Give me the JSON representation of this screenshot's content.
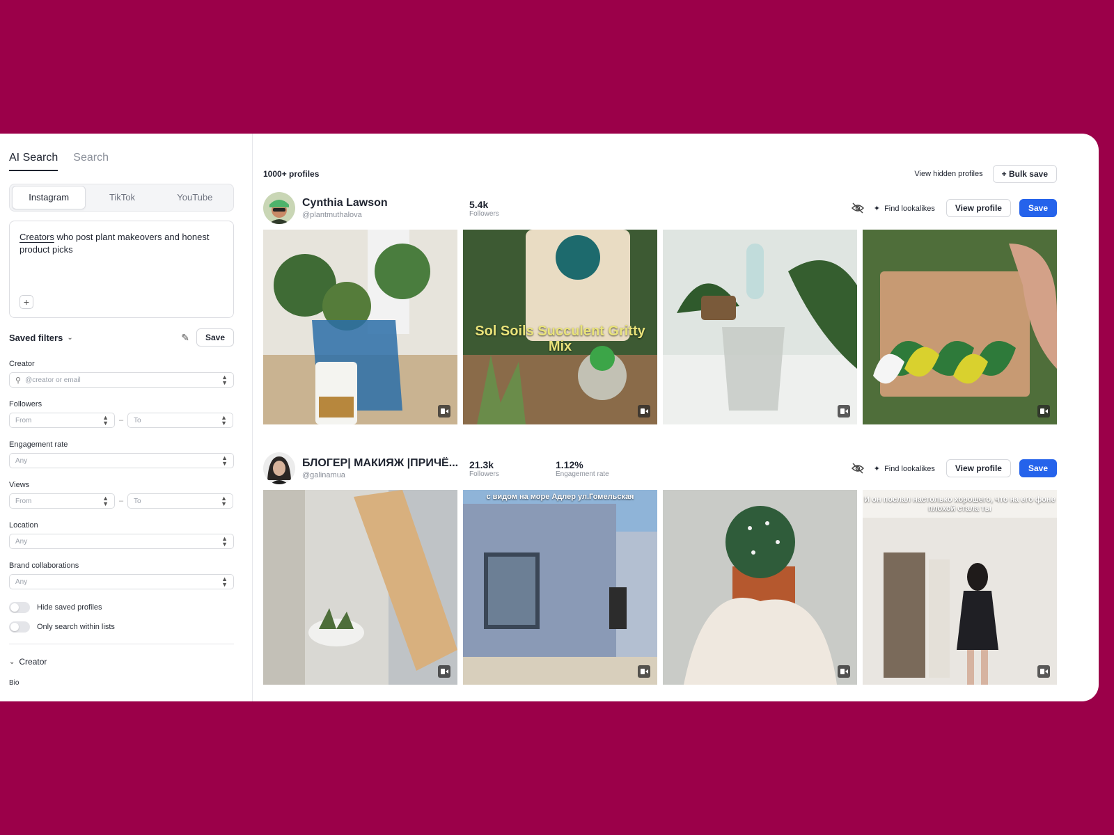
{
  "sidebar": {
    "mode_tabs": [
      "AI Search",
      "Search"
    ],
    "platforms": [
      "Instagram",
      "TikTok",
      "YouTube"
    ],
    "prompt_highlight": "Creators",
    "prompt_rest": " who post plant makeovers and honest product picks",
    "saved_filters_label": "Saved filters",
    "save_label": "Save",
    "creator_label": "Creator",
    "creator_placeholder": "@creator or email",
    "followers_label": "Followers",
    "from_placeholder": "From",
    "to_placeholder": "To",
    "engagement_label": "Engagement rate",
    "any_placeholder": "Any",
    "views_label": "Views",
    "location_label": "Location",
    "brand_label": "Brand collaborations",
    "hide_saved_label": "Hide saved profiles",
    "only_lists_label": "Only search within lists",
    "creator_section_label": "Creator",
    "bio_label": "Bio"
  },
  "main": {
    "count": "1000+ profiles",
    "view_hidden": "View hidden profiles",
    "bulk_save": "+ Bulk save",
    "find_lookalikes": "Find lookalikes",
    "view_profile": "View profile",
    "save": "Save",
    "profiles": [
      {
        "name": "Cynthia Lawson",
        "handle": "@plantmuthalova",
        "followers_value": "5.4k",
        "followers_label": "Followers",
        "thumb_captions": [
          "",
          "Sol Soils Succulent Gritty Mix",
          "",
          ""
        ]
      },
      {
        "name": "БЛОГЕР| МАКИЯЖ |ПРИЧЁ...",
        "handle": "@galinamua",
        "followers_value": "21.3k",
        "followers_label": "Followers",
        "engagement_value": "1.12%",
        "engagement_label": "Engagement rate",
        "thumb_captions": [
          "",
          "с видом на море Адлер ул.Гомельская",
          "",
          "И он послал настолько хорошего, что на его фоне плохой стала ты"
        ]
      }
    ]
  },
  "colors": {
    "background": "#9b0049",
    "primary": "#2563eb"
  }
}
